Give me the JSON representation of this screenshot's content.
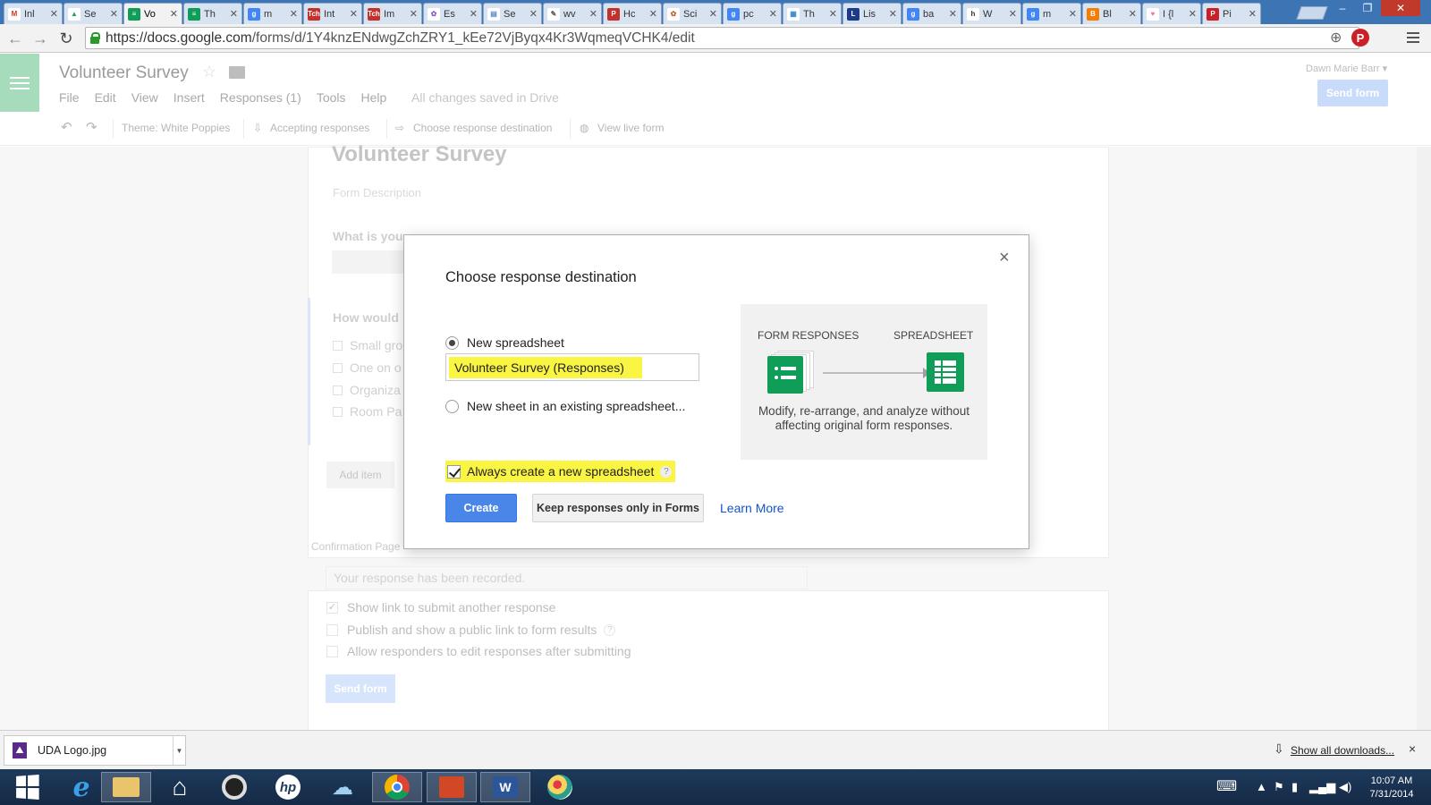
{
  "browser": {
    "tabs": [
      {
        "label": "Inl",
        "fav": "M",
        "color": "#ffffff",
        "fg": "#d93025"
      },
      {
        "label": "Se",
        "fav": "▲",
        "color": "#ffffff",
        "fg": "#1aa260"
      },
      {
        "label": "Vo",
        "fav": "≡",
        "color": "#0f9d58",
        "fg": "#ffffff",
        "active": true
      },
      {
        "label": "Th",
        "fav": "≡",
        "color": "#0f9d58",
        "fg": "#ffffff"
      },
      {
        "label": "m",
        "fav": "g",
        "color": "#4285f4",
        "fg": "#ffffff"
      },
      {
        "label": "Int",
        "fav": "Tch",
        "color": "#c4302b",
        "fg": "#ffffff"
      },
      {
        "label": "Im",
        "fav": "Tch",
        "color": "#c4302b",
        "fg": "#ffffff"
      },
      {
        "label": "Es",
        "fav": "✿",
        "color": "#ffffff",
        "fg": "#8a5ac8"
      },
      {
        "label": "Se",
        "fav": "▤",
        "color": "#ffffff",
        "fg": "#5a8ac8"
      },
      {
        "label": "wv",
        "fav": "✎",
        "color": "#ffffff",
        "fg": "#555555"
      },
      {
        "label": "Hc",
        "fav": "P",
        "color": "#c4302b",
        "fg": "#ffffff"
      },
      {
        "label": "Sci",
        "fav": "✿",
        "color": "#ffffff",
        "fg": "#cc5a2a"
      },
      {
        "label": "pc",
        "fav": "g",
        "color": "#4285f4",
        "fg": "#ffffff"
      },
      {
        "label": "Th",
        "fav": "▦",
        "color": "#ffffff",
        "fg": "#3a8ac8"
      },
      {
        "label": "Lis",
        "fav": "L",
        "color": "#1b3a8a",
        "fg": "#ffffff"
      },
      {
        "label": "ba",
        "fav": "g",
        "color": "#4285f4",
        "fg": "#ffffff"
      },
      {
        "label": "W",
        "fav": "h",
        "color": "#ffffff",
        "fg": "#333333"
      },
      {
        "label": "m",
        "fav": "g",
        "color": "#4285f4",
        "fg": "#ffffff"
      },
      {
        "label": "Bl",
        "fav": "B",
        "color": "#f57d00",
        "fg": "#ffffff"
      },
      {
        "label": "I {l",
        "fav": "♥",
        "color": "#ffffff",
        "fg": "#e07aa8"
      },
      {
        "label": "Pi",
        "fav": "P",
        "color": "#cb2027",
        "fg": "#ffffff"
      }
    ],
    "url_host": "https://docs.google.com",
    "url_path": "/forms/d/1Y4knzENdwgZchZRY1_kEe72VjByqx4Kr3WqmeqVCHK4/edit",
    "pinterest_label": "P"
  },
  "forms": {
    "doc_title": "Volunteer Survey",
    "menu": [
      "File",
      "Edit",
      "View",
      "Insert",
      "Responses (1)",
      "Tools",
      "Help"
    ],
    "saved_status": "All changes saved in Drive",
    "user_name": "Dawn Marie Barr ▾",
    "send_form_top": "Send form",
    "theme": "Theme: White Poppies",
    "accepting": "Accepting responses",
    "choose_dest": "Choose response destination",
    "view_live": "View live form",
    "form_title": "Volunteer Survey",
    "form_desc": "Form Description",
    "q1": "What is you",
    "q2": "How would",
    "options": [
      "Small gro",
      "One on o",
      "Organiza",
      "Room Pa"
    ],
    "add_item": "Add item",
    "confirmation_label": "Confirmation Page",
    "confirmation_text": "Your response has been recorded.",
    "checks": [
      {
        "label": "Show link to submit another response",
        "checked": true
      },
      {
        "label": "Publish and show a public link to form results",
        "checked": false,
        "help": "?"
      },
      {
        "label": "Allow responders to edit responses after submitting",
        "checked": false
      }
    ],
    "send_form_bottom": "Send form"
  },
  "dialog": {
    "title": "Choose response destination",
    "close": "×",
    "option_new": "New spreadsheet",
    "spreadsheet_name": "Volunteer Survey (Responses)",
    "option_existing": "New sheet in an existing spreadsheet...",
    "always_create": "Always create a new spreadsheet",
    "help": "?",
    "create": "Create",
    "keep": "Keep responses only in Forms",
    "learn_more": "Learn More",
    "illus_left": "FORM RESPONSES",
    "illus_right": "SPREADSHEET",
    "illus_desc": "Modify, re-arrange, and analyze without affecting original form responses."
  },
  "downloads": {
    "file": "UDA Logo.jpg",
    "show_all": "Show all downloads...",
    "close": "×"
  },
  "taskbar": {
    "time": "10:07 AM",
    "date": "7/31/2014"
  }
}
